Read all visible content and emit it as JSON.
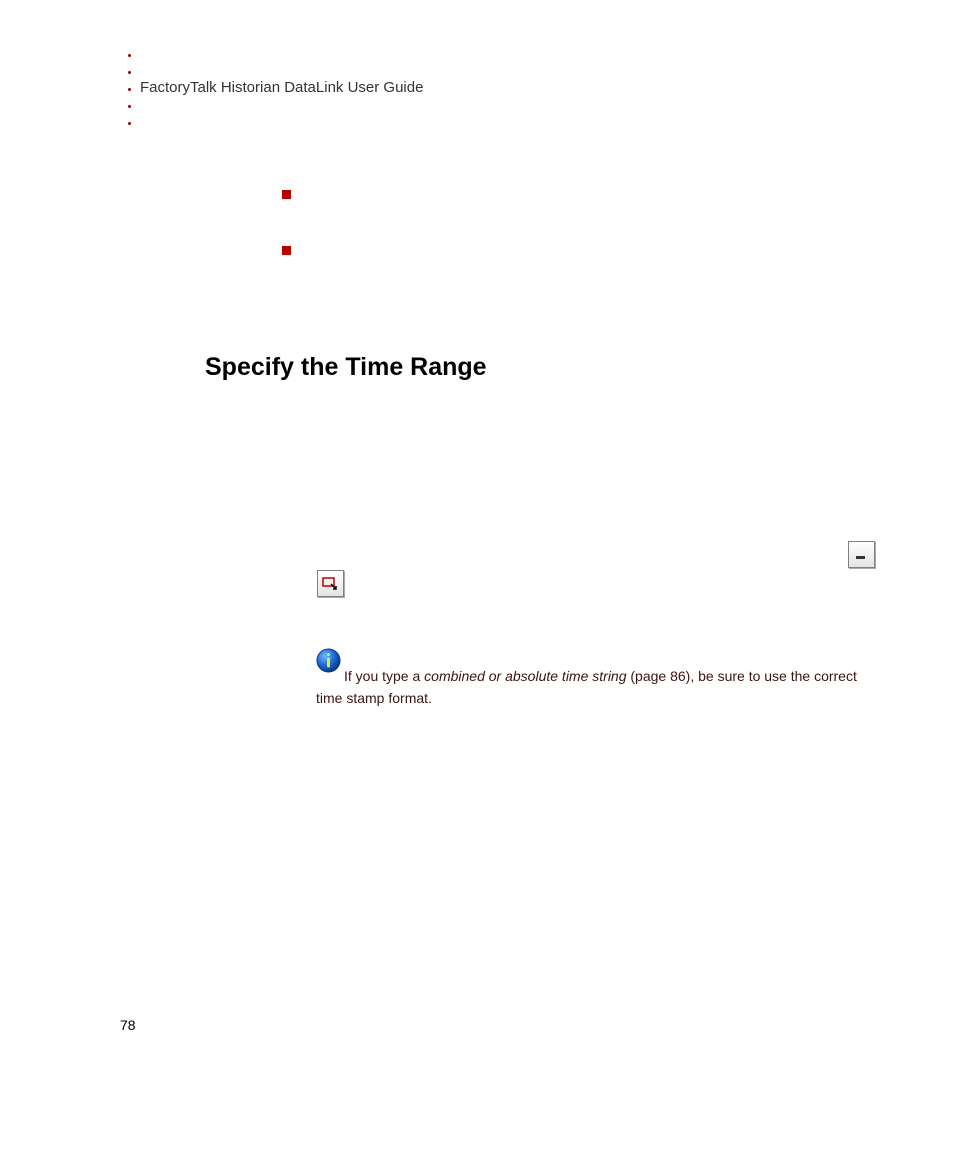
{
  "header": {
    "running_head": "FactoryTalk Historian DataLink User Guide"
  },
  "section": {
    "heading": "Specify the Time Range"
  },
  "note": {
    "lead": "If you type a ",
    "link_text": "combined or absolute time string",
    "page_ref": " (page 86)",
    "tail": ", be sure to use the correct time stamp format."
  },
  "page_number": "78",
  "icons": {
    "cell_select": "cell-select-icon",
    "dropdown": "dropdown-icon",
    "info": "info-icon"
  }
}
